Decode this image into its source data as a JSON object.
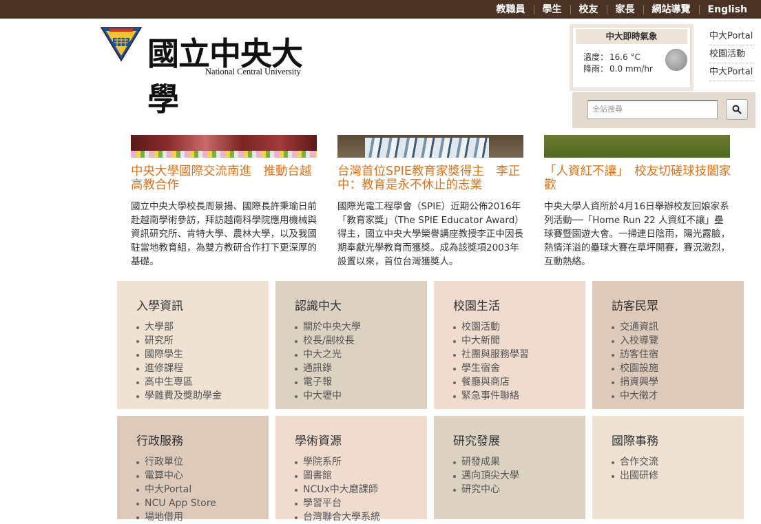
{
  "topnav": [
    "教職員",
    "學生",
    "校友",
    "家長",
    "網站導覽",
    "English"
  ],
  "logo": {
    "cn": "國立中央大學",
    "en": "National Central University",
    "emblem_text": "國立中央大學"
  },
  "weather": {
    "title": "中大即時氣象",
    "temp_label": "溫度：",
    "temp_value": "16.6 °C",
    "rain_label": "降雨：",
    "rain_value": "0.0 mm/hr"
  },
  "side_links": [
    "中大Portal",
    "校園活動",
    "中大Portal"
  ],
  "search": {
    "placeholder": "全站搜尋"
  },
  "news": [
    {
      "title": "中央大學國際交流南進　推動台越高教合作",
      "body": "國立中央大學校長周景揚、國際長許秉瑜日前赴越南學術參訪，拜訪越南科學院應用機械與資訊研究所、肯特大學、農林大學，以及我國駐當地教育組，為雙方教研合作打下更深厚的基礎。"
    },
    {
      "title": "台灣首位SPIE教育家獎得主　李正中：教育是永不休止的志業",
      "body": "國際光電工程學會（SPIE）近期公佈2016年「教育家獎」（The SPIE Educator Award）得主，國立中央大學榮譽講座教授李正中因長期奉獻光學教育而獲獎。成為該獎項2003年設置以來，首位台灣獲獎人。"
    },
    {
      "title": "「人資紅不讓」　校友切磋球技闔家歡",
      "body": "中央大學人資所於4月16日舉辦校友回娘家系列活動──「Home Run 22 人資紅不讓」壘球賽暨園遊大會。一掃連日陰雨，陽光露臉，熱情洋溢的壘球大賽在草坪開賽，賽況激烈，互動熱絡。"
    }
  ],
  "cards": [
    {
      "title": "入學資訊",
      "color": "#efe2d2",
      "items": [
        "大學部",
        "研究所",
        "國際學生",
        "進修課程",
        "高中生專區",
        "學雜費及獎助學金"
      ]
    },
    {
      "title": "認識中大",
      "color": "#ddd2c2",
      "items": [
        "關於中央大學",
        "校長/副校長",
        "中大之光",
        "通訊錄",
        "電子報",
        "中大壢中"
      ]
    },
    {
      "title": "校園生活",
      "color": "#efdccf",
      "items": [
        "校園活動",
        "中大新聞",
        "社團與服務學習",
        "學生宿舍",
        "餐廳與商店",
        "緊急事件聯絡"
      ]
    },
    {
      "title": "訪客民眾",
      "color": "#decabb",
      "items": [
        "交通資訊",
        "入校導覽",
        "訪客住宿",
        "校園設施",
        "捐資興學",
        "中大徵才"
      ]
    },
    {
      "title": "行政服務",
      "color": "#decabb",
      "items": [
        "行政單位",
        "電算中心",
        "中大Portal",
        "NCU App Store",
        "場地借用"
      ]
    },
    {
      "title": "學術資源",
      "color": "#efdccf",
      "items": [
        "學院系所",
        "圖書館",
        "NCUx中大磨課師",
        "學習平台",
        "台灣聯合大學系統"
      ]
    },
    {
      "title": "研究發展",
      "color": "#ddd2c2",
      "items": [
        "研發成果",
        "邁向頂尖大學",
        "研究中心"
      ]
    },
    {
      "title": "國際事務",
      "color": "#efe2d2",
      "items": [
        "合作交流",
        "出國研修"
      ]
    }
  ]
}
